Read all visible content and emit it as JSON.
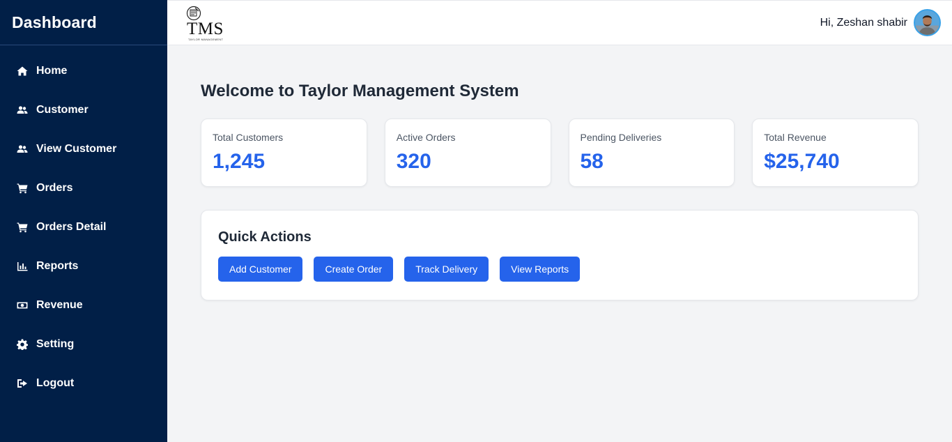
{
  "sidebar": {
    "title": "Dashboard",
    "items": [
      {
        "label": "Home",
        "icon": "home-icon"
      },
      {
        "label": "Customer",
        "icon": "users-icon"
      },
      {
        "label": "View Customer",
        "icon": "users-icon"
      },
      {
        "label": "Orders",
        "icon": "cart-icon"
      },
      {
        "label": "Orders Detail",
        "icon": "cart-icon"
      },
      {
        "label": "Reports",
        "icon": "bar-chart-icon"
      },
      {
        "label": "Revenue",
        "icon": "money-icon"
      },
      {
        "label": "Setting",
        "icon": "gear-icon"
      },
      {
        "label": "Logout",
        "icon": "logout-icon"
      }
    ]
  },
  "header": {
    "logo_text": "TMS",
    "logo_subtitle": "TAYLOR MANAGEMENT",
    "greeting": "Hi, Zeshan shabir"
  },
  "main": {
    "welcome": "Welcome to Taylor Management System",
    "stats": [
      {
        "label": "Total Customers",
        "value": "1,245"
      },
      {
        "label": "Active Orders",
        "value": "320"
      },
      {
        "label": "Pending Deliveries",
        "value": "58"
      },
      {
        "label": "Total Revenue",
        "value": "$25,740"
      }
    ],
    "quick_actions": {
      "title": "Quick Actions",
      "buttons": [
        {
          "label": "Add Customer"
        },
        {
          "label": "Create Order"
        },
        {
          "label": "Track Delivery"
        },
        {
          "label": "View Reports"
        }
      ]
    }
  },
  "colors": {
    "sidebar_bg": "#011f47",
    "accent": "#2563eb",
    "page_bg": "#f3f4f6"
  }
}
